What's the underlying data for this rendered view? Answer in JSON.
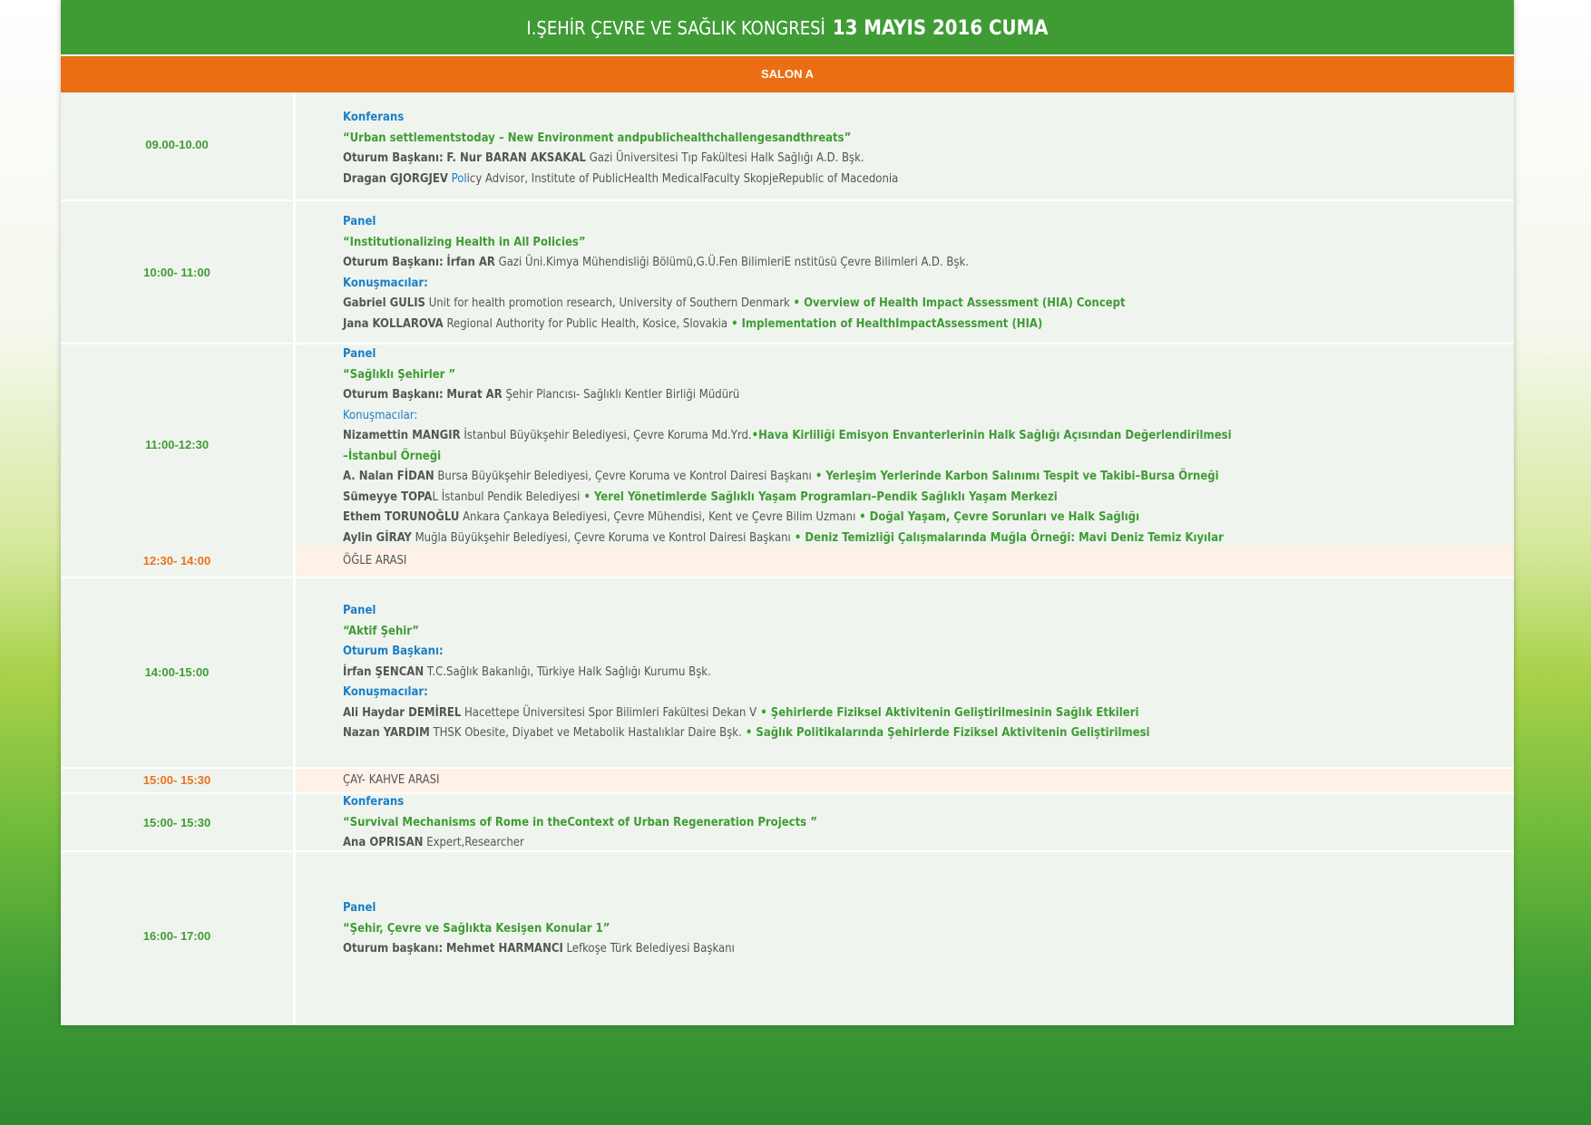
{
  "header": {
    "title": "I.ŞEHİR ÇEVRE VE SAĞLIK KONGRESİ",
    "date": "13 MAYIS 2016 CUMA"
  },
  "salon": "SALON A",
  "s1": {
    "time": "09.00-10.00",
    "type": "Konferans",
    "title": "“Urban settlementstoday –  New Environment andpublichealthchallengesandthreats”",
    "chair_label": "Oturum Başkanı:",
    "chair_name": "F. Nur BARAN AKSAKAL",
    "chair_aff": "  Gazi Üniversitesi Tıp Fakültesi Halk Sağlığı A.D. Bşk.",
    "sp_name": "Dragan GJORGJEV",
    "sp_aff_a": "Pol",
    "sp_aff_b": "icy Advisor, Institute of PublicHealth MedicalFaculty SkopjeRepublic of Macedonia"
  },
  "s2": {
    "time": "10:00- 11:00",
    "type": "Panel",
    "title": "“Institutionalizing Health in All Policies”",
    "chair_label": "Oturum Başkanı:",
    "chair_name": "İrfan AR",
    "chair_aff": "Gazi Üni.Kimya Mühendisliği Bölümü,G.Ü.Fen BilimleriE nstitüsü Çevre Bilimleri A.D. Bşk.",
    "speakers_label": "Konuşmacılar:",
    "sp1_name": "Gabriel GULIS",
    "sp1_aff": "Unit for health promotion research, University of Southern Denmark ",
    "sp1_topic": " • Overview of Health Impact Assessment (HIA) Concept",
    "sp2_name": "Jana KOLLAROVA",
    "sp2_aff": "Regional Authority for Public Health, Kosice, Slovakia",
    "sp2_topic": " • Implementation of HealthImpactAssessment (HIA)"
  },
  "s3": {
    "time": "11:00-12:30",
    "type": "Panel",
    "title": "“Sağlıklı Şehirler ”",
    "chair_label": "Oturum Başkanı:",
    "chair_name": "Murat AR",
    "chair_aff": "Şehir Plancısı- Sağlıklı Kentler Birliği Müdürü",
    "speakers_label": "Konuşmacılar:",
    "sp1_name": "Nizamettin MANGIR",
    "sp1_aff": "İstanbul Büyükşehir Belediyesi, Çevre Koruma Md.Yrd.",
    "sp1_topic": "•Hava Kirliliği Emisyon Envanterlerinin Halk Sağlığı Açısından Değerlendirilmesi",
    "sp1_topic2": "–İstanbul Örneği",
    "sp2_name": "A. Nalan FİDAN",
    "sp2_aff": "Bursa Büyükşehir Belediyesi, Çevre Koruma ve Kontrol Dairesi Başkanı",
    "sp2_topic": " • Yerleşim Yerlerinde Karbon Salınımı Tespit ve Takibi–Bursa Örneği",
    "sp3_name": "Sümeyye TOPA",
    "sp3_aff": "L İstanbul Pendik Belediyesi",
    "sp3_topic": " • Yerel Yönetimlerde Sağlıklı Yaşam Programları–Pendik Sağlıklı Yaşam Merkezi",
    "sp4_name": "Ethem TORUNOĞLU",
    "sp4_aff": "Ankara Çankaya Belediyesi,  Çevre Mühendisi, Kent ve Çevre Bilim Uzmanı ",
    "sp4_topic": " • Doğal Yaşam, Çevre Sorunları ve Halk Sağlığı",
    "sp5_name": "Aylin GİRAY",
    "sp5_aff": "Muğla Büyükşehir Belediyesi, Çevre Koruma ve Kontrol Dairesi Başkanı",
    "sp5_topic": " • Deniz Temizliği Çalışmalarında Muğla Örneği: Mavi Deniz Temiz Kıyılar"
  },
  "b1": {
    "time": "12:30-  14:00",
    "label": "ÖĞLE ARASI"
  },
  "s4": {
    "time": "14:00-15:00",
    "type": "Panel",
    "title": "“Aktif Şehir”",
    "chair_label": "Oturum Başkanı:",
    "chair_name": "İrfan ŞENCAN",
    "chair_aff": "T.C.Sağlık Bakanlığı, Türkiye Halk Sağlığı Kurumu Bşk.",
    "speakers_label": "Konuşmacılar:",
    "sp1_name": "Ali Haydar DEMİREL",
    "sp1_aff": "Hacettepe Üniversitesi Spor Bilimleri Fakültesi Dekan V",
    "sp1_topic": " • Şehirlerde Fiziksel Aktivitenin Geliştirilmesinin Sağlık Etkileri",
    "sp2_name": "Nazan YARDIM",
    "sp2_aff": "THSK Obesite, Diyabet ve Metabolik Hastalıklar Daire Bşk.",
    "sp2_topic": " • Sağlık Politikalarında Şehirlerde Fiziksel Aktivitenin Geliştirilmesi"
  },
  "b2": {
    "time": "15:00- 15:30",
    "label": "ÇAY- KAHVE ARASI"
  },
  "s5": {
    "time": "15:00- 15:30",
    "type": "Konferans",
    "title": "“Survival Mechanisms of Rome in theContext of Urban  Regeneration Projects ”",
    "sp_name": "Ana OPRISAN",
    "sp_aff": "Expert,Researcher"
  },
  "s6": {
    "time": "16:00- 17:00",
    "type": "Panel",
    "title": "“Şehir, Çevre ve Sağlıkta Kesişen Konular 1”",
    "chair_label": "Oturum başkanı:",
    "chair_name": " Mehmet HARMANCI",
    "chair_aff": "Lefkoşe Türk Belediyesi Başkanı"
  }
}
